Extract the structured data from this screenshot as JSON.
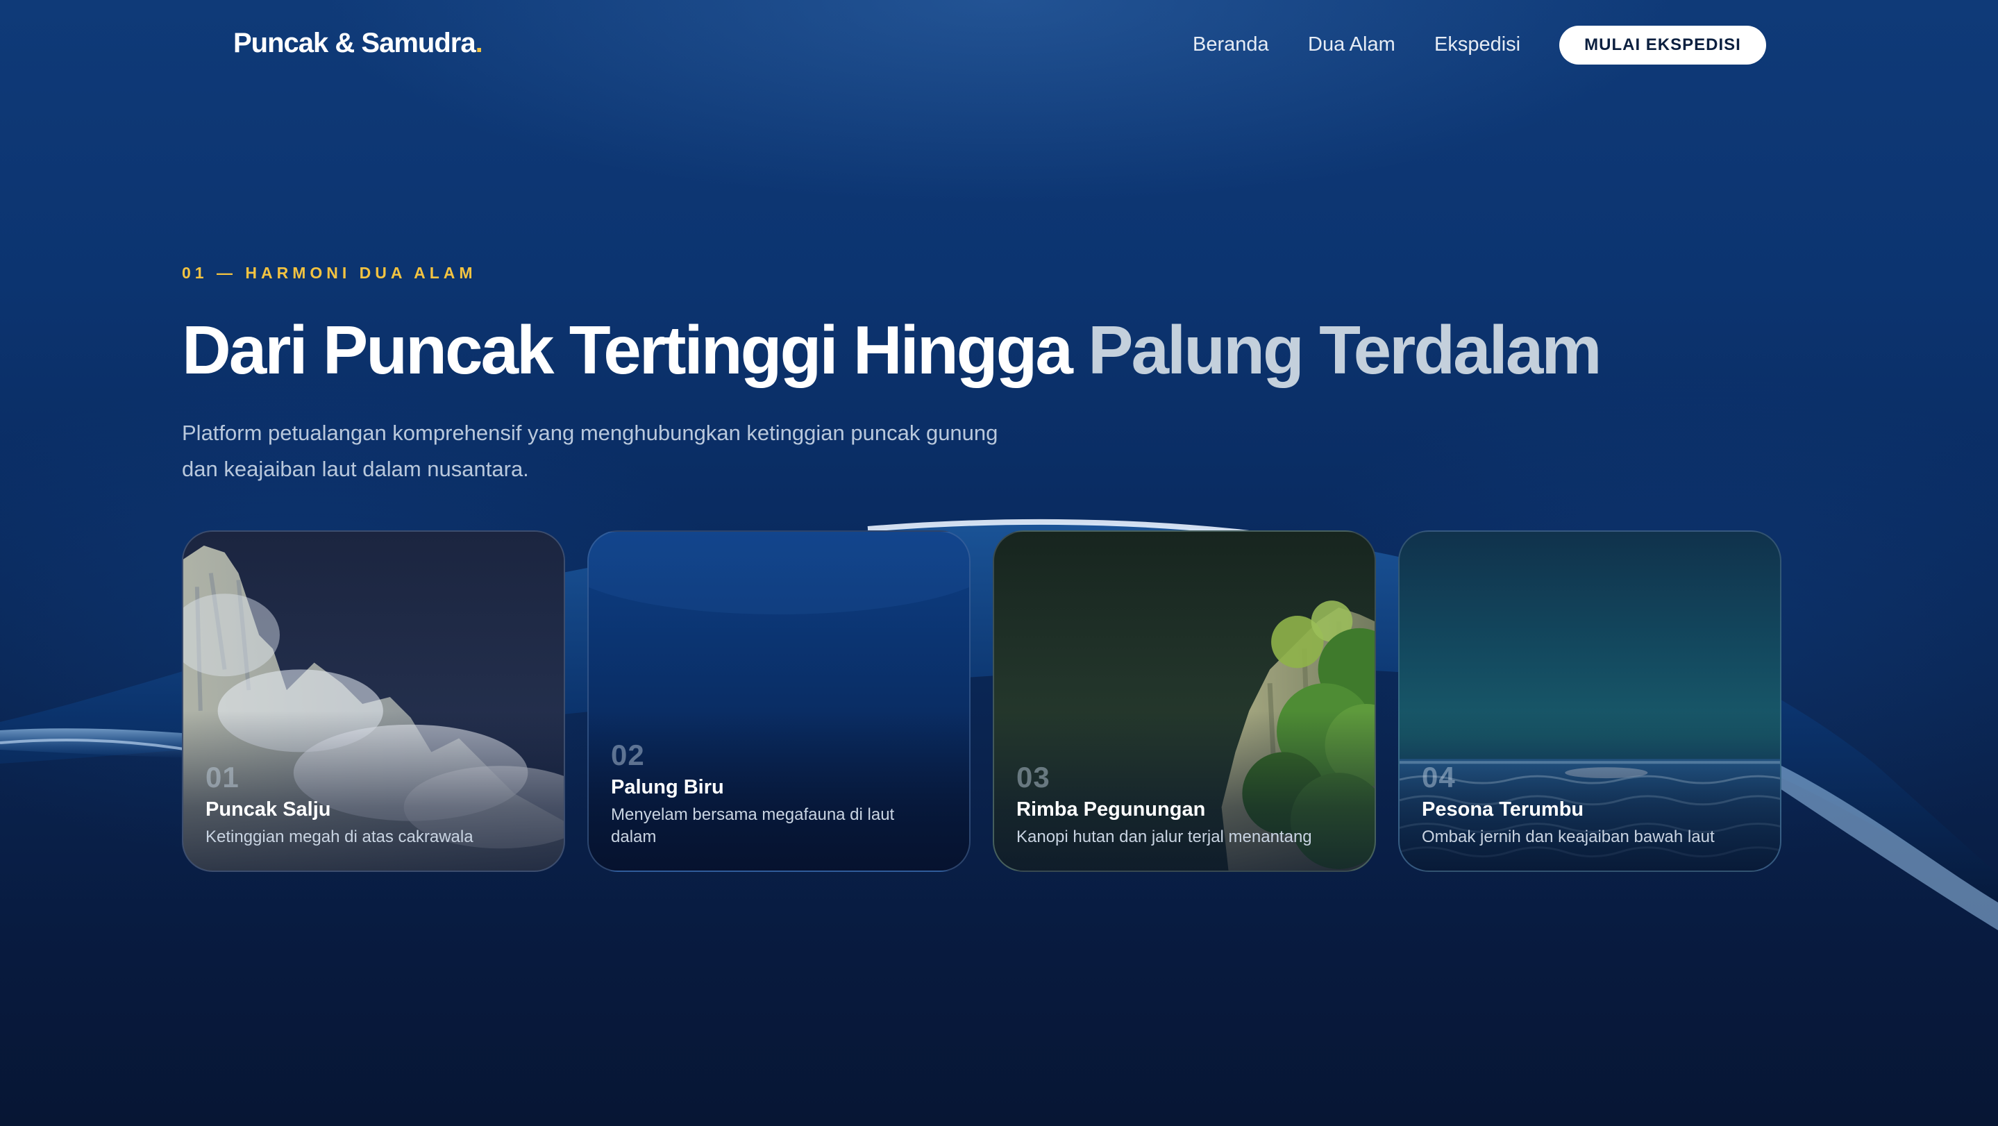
{
  "brand": {
    "name": "Puncak & Samudra",
    "dot": ".",
    "accent_color": "#f3c341"
  },
  "nav": {
    "links": [
      "Beranda",
      "Dua Alam",
      "Ekspedisi"
    ],
    "cta": "MULAI EKSPEDISI"
  },
  "hero": {
    "eyebrow": "01 — HARMONI DUA ALAM",
    "headline_main": "Dari Puncak Tertinggi Hingga",
    "headline_accent": "Palung Terdalam",
    "subtitle": "Platform petualangan komprehensif yang menghubungkan ketinggian puncak gunung dan keajaiban laut dalam nusantara."
  },
  "cards": [
    {
      "number": "01",
      "title": "Puncak Salju",
      "description": "Ketinggian megah di atas cakrawala",
      "image_icon": "snowy-cliff-icon"
    },
    {
      "number": "02",
      "title": "Palung Biru",
      "description": "Menyelam bersama megafauna di laut dalam",
      "image_icon": "deep-sea-icon"
    },
    {
      "number": "03",
      "title": "Rimba Pegunungan",
      "description": "Kanopi hutan dan jalur terjal menantang",
      "image_icon": "forest-cliff-icon"
    },
    {
      "number": "04",
      "title": "Pesona Terumbu",
      "description": "Ombak jernih dan keajaiban bawah laut",
      "image_icon": "ocean-waves-icon"
    }
  ]
}
